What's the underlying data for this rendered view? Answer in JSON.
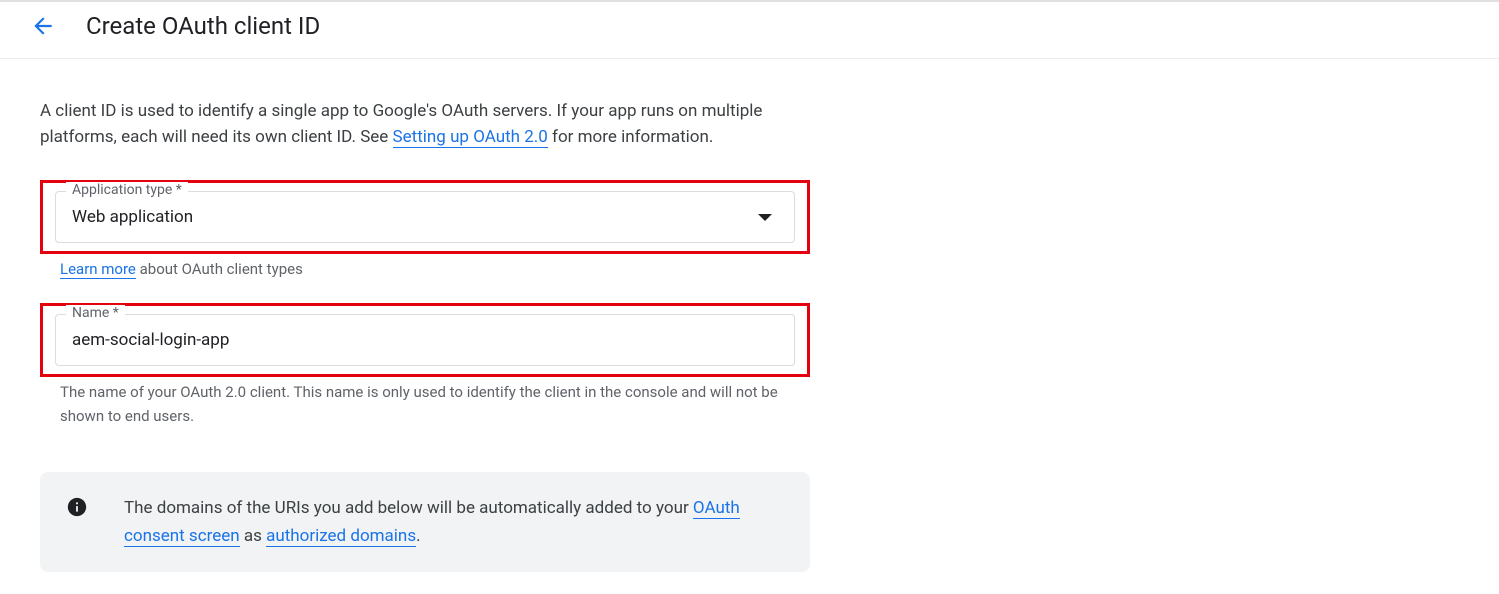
{
  "header": {
    "title": "Create OAuth client ID"
  },
  "intro": {
    "part1": "A client ID is used to identify a single app to Google's OAuth servers. If your app runs on multiple platforms, each will need its own client ID. See ",
    "link": "Setting up OAuth 2.0",
    "part2": " for more information."
  },
  "appType": {
    "label": "Application type *",
    "value": "Web application",
    "hintPrefix": "Learn more",
    "hintSuffix": " about OAuth client types"
  },
  "nameField": {
    "label": "Name *",
    "value": "aem-social-login-app",
    "hint": "The name of your OAuth 2.0 client. This name is only used to identify the client in the console and will not be shown to end users."
  },
  "infoBanner": {
    "part1": "The domains of the URIs you add below will be automatically added to your ",
    "link1": "OAuth consent screen",
    "mid": " as ",
    "link2": "authorized domains",
    "end": "."
  }
}
